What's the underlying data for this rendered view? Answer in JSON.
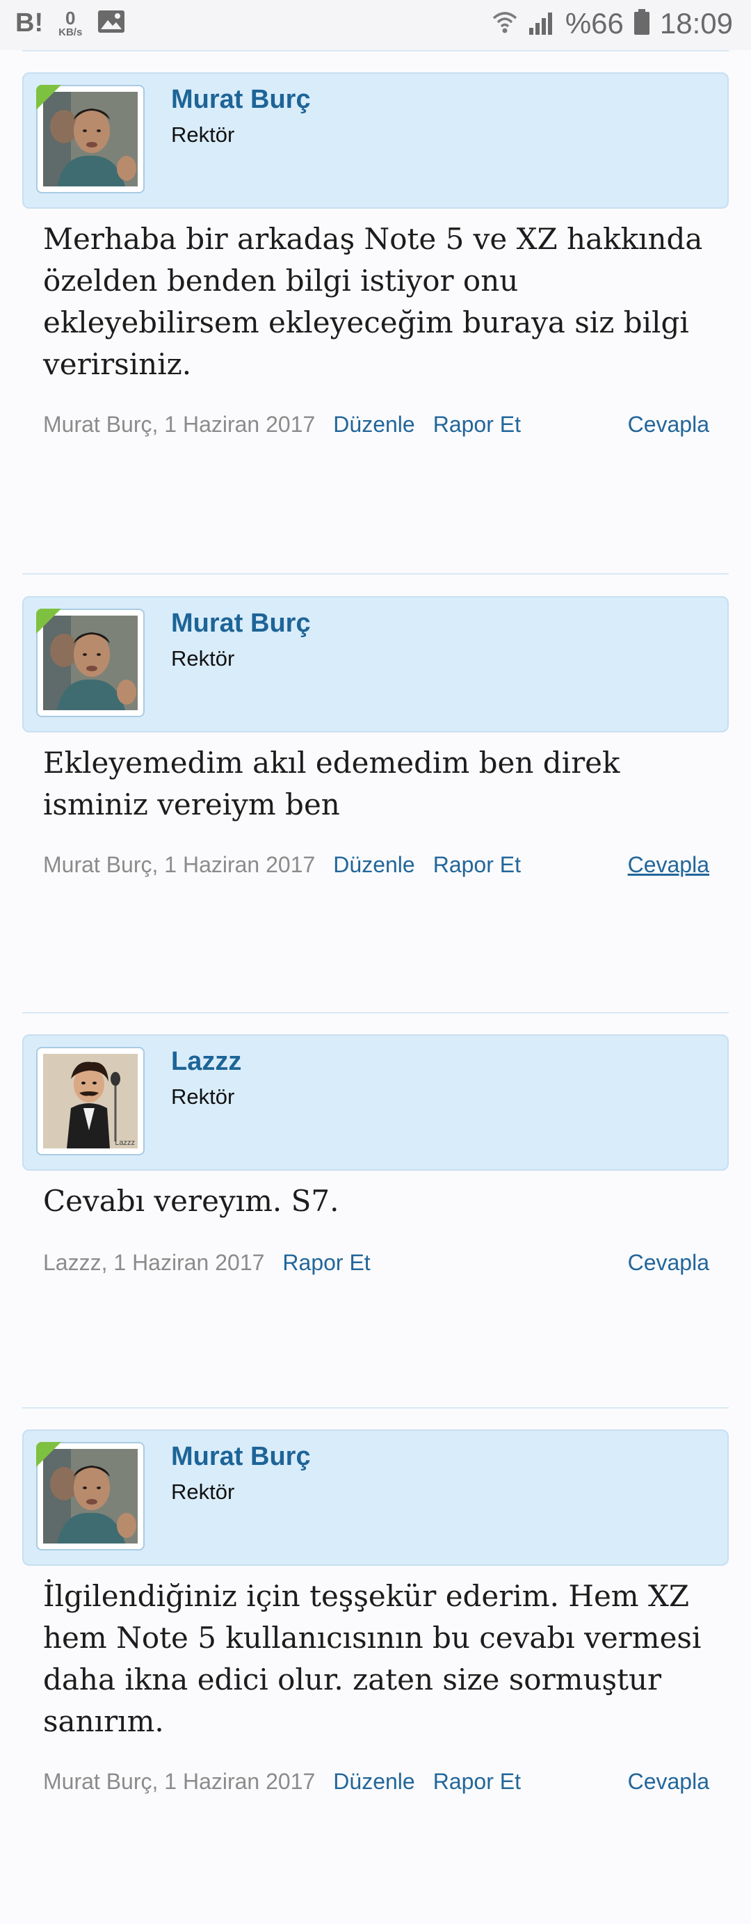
{
  "status_bar": {
    "app_icon": "B!",
    "speed_value": "0",
    "speed_unit": "KB/s",
    "image_icon": "image-icon",
    "wifi_icon": "wifi-icon",
    "signal_icon": "signal-icon",
    "battery_percent": "%66",
    "battery_icon": "battery-icon",
    "time": "18:09"
  },
  "colors": {
    "user_panel_bg": "#d9ecfa",
    "link": "#22669a",
    "username": "#1d6497",
    "staff_leaf": "#7ec141"
  },
  "posts": [
    {
      "username": "Murat Burç",
      "user_title": "Rektör",
      "message": "Merhaba bir arkadaş Note 5 ve XZ hakkında özelden benden bilgi istiyor onu ekleyebilirsem ekleyeceğim buraya siz bilgi verirsiniz.",
      "date_text": "Murat Burç, 1 Haziran 2017",
      "edit_label": "Düzenle",
      "report_label": "Rapor Et",
      "reply_label": "Cevapla"
    },
    {
      "username": "Murat Burç",
      "user_title": "Rektör",
      "message": "Ekleyemedim akıl edemedim ben direk isminiz vereiym ben",
      "date_text": "Murat Burç, 1 Haziran 2017",
      "edit_label": "Düzenle",
      "report_label": "Rapor Et",
      "reply_label": "Cevapla"
    },
    {
      "username": "Lazzz",
      "user_title": "Rektör",
      "message": "Cevabı vereyım. S7.",
      "date_text": "Lazzz, 1 Haziran 2017",
      "report_label": "Rapor Et",
      "reply_label": "Cevapla",
      "avatar_watermark": "Lazzz"
    },
    {
      "username": "Murat Burç",
      "user_title": "Rektör",
      "message": "İlgilendiğiniz için teşşekür ederim. Hem XZ hem Note 5 kullanıcısının bu cevabı vermesi daha ikna edici olur. zaten size sormuştur sanırım.",
      "date_text": "Murat Burç, 1 Haziran 2017",
      "edit_label": "Düzenle",
      "report_label": "Rapor Et",
      "reply_label": "Cevapla"
    }
  ]
}
